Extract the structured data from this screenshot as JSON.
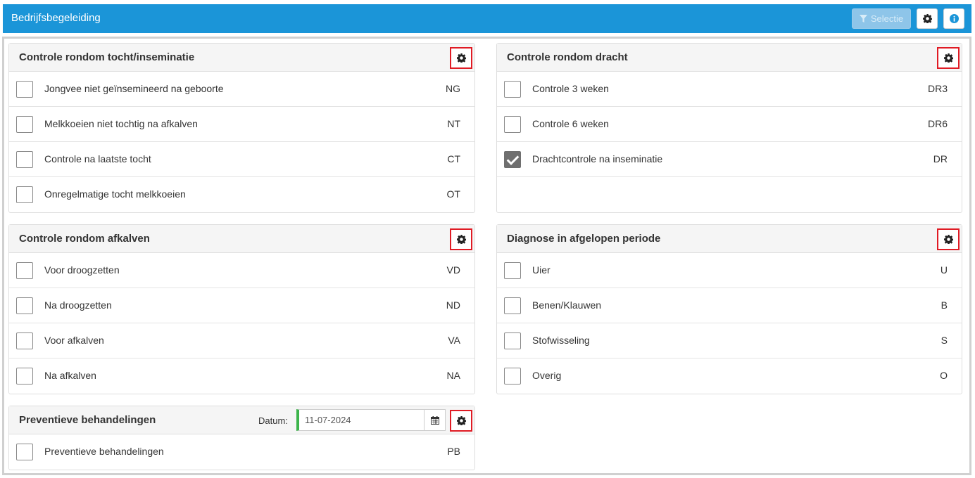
{
  "app": {
    "title": "Bedrijfsbegeleiding",
    "selectie_label": "Selectie"
  },
  "panels": {
    "tocht": {
      "title": "Controle rondom tocht/inseminatie",
      "rows": [
        {
          "label": "Jongvee niet geïnsemineerd na geboorte",
          "code": "NG",
          "checked": false
        },
        {
          "label": "Melkkoeien niet tochtig na afkalven",
          "code": "NT",
          "checked": false
        },
        {
          "label": "Controle na laatste tocht",
          "code": "CT",
          "checked": false
        },
        {
          "label": "Onregelmatige tocht melkkoeien",
          "code": "OT",
          "checked": false
        }
      ]
    },
    "dracht": {
      "title": "Controle rondom dracht",
      "rows": [
        {
          "label": "Controle 3 weken",
          "code": "DR3",
          "checked": false
        },
        {
          "label": "Controle 6 weken",
          "code": "DR6",
          "checked": false
        },
        {
          "label": "Drachtcontrole na inseminatie",
          "code": "DR",
          "checked": true
        }
      ]
    },
    "afkalven": {
      "title": "Controle rondom afkalven",
      "rows": [
        {
          "label": "Voor droogzetten",
          "code": "VD",
          "checked": false
        },
        {
          "label": "Na droogzetten",
          "code": "ND",
          "checked": false
        },
        {
          "label": "Voor afkalven",
          "code": "VA",
          "checked": false
        },
        {
          "label": "Na afkalven",
          "code": "NA",
          "checked": false
        }
      ]
    },
    "diagnose": {
      "title": "Diagnose in afgelopen periode",
      "rows": [
        {
          "label": "Uier",
          "code": "U",
          "checked": false
        },
        {
          "label": "Benen/Klauwen",
          "code": "B",
          "checked": false
        },
        {
          "label": "Stofwisseling",
          "code": "S",
          "checked": false
        },
        {
          "label": "Overig",
          "code": "O",
          "checked": false
        }
      ]
    },
    "preventief": {
      "title": "Preventieve behandelingen",
      "datum_label": "Datum:",
      "datum_value": "11-07-2024",
      "rows": [
        {
          "label": "Preventieve behandelingen",
          "code": "PB",
          "checked": false
        }
      ]
    }
  },
  "colors": {
    "topbar": "#1b95d8",
    "highlight": "#e01b24",
    "date_accent": "#3cb44b"
  }
}
